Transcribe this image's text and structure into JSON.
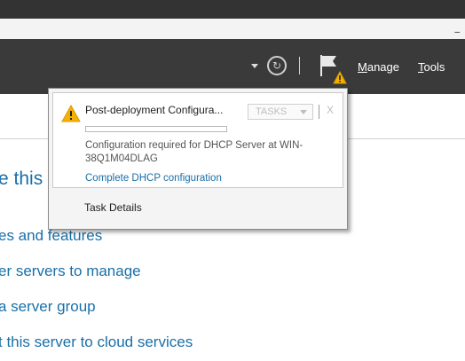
{
  "window": {
    "minimize_glyph": "_"
  },
  "toolbar": {
    "manage_prefix": "M",
    "manage_rest": "anage",
    "tools_prefix": "T",
    "tools_rest": "ools",
    "refresh_icon": "refresh-icon",
    "notifications_icon": "flag-warning-icon"
  },
  "background": {
    "heading": "e this",
    "links": [
      "es and features",
      "er servers to manage",
      "a server group",
      "t this server to cloud services"
    ]
  },
  "notification": {
    "title": "Post-deployment Configura...",
    "tasks_label": "TASKS",
    "close_label": "X",
    "progress": 0,
    "description": "Configuration required for DHCP Server at WIN-38Q1M04DLAG",
    "action_link": "Complete DHCP configuration",
    "task_details": "Task Details"
  },
  "colors": {
    "accent_link": "#1a6fa8",
    "warning": "#f5b000",
    "toolbar_bg": "#3a3a3a"
  }
}
